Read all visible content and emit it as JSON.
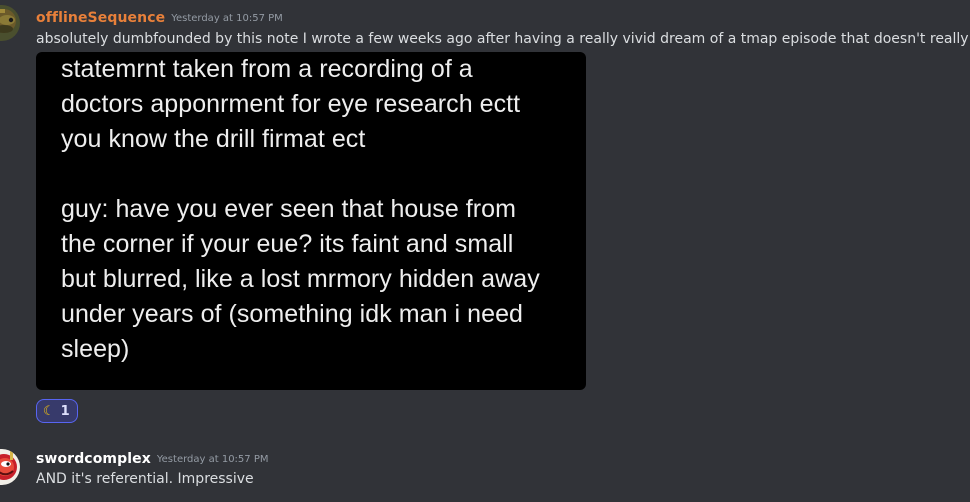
{
  "messages": [
    {
      "username": "offlineSequence",
      "username_color": "#e8803a",
      "timestamp": "Yesterday at 10:57 PM",
      "text": "absolutely dumbfounded by this note I wrote a few weeks ago after having a really vivid dream of a tmap episode that doesn't really exist",
      "attachment_text": "statemrnt taken from a recording of a\ndoctors apponrment for eye research ectt\nyou know the drill firmat ect\n\nguy: have you ever seen that house from\nthe corner if your eue? its faint and small\nbut blurred, like a lost mrmory hidden away\nunder years of (something idk man i need\nsleep)",
      "reaction": {
        "icon": "crescent-moon",
        "emoji": "☾",
        "count": "1"
      }
    },
    {
      "username": "swordcomplex",
      "username_color": "#ffffff",
      "timestamp": "Yesterday at 10:57 PM",
      "text": "AND it's referential. Impressive"
    }
  ]
}
